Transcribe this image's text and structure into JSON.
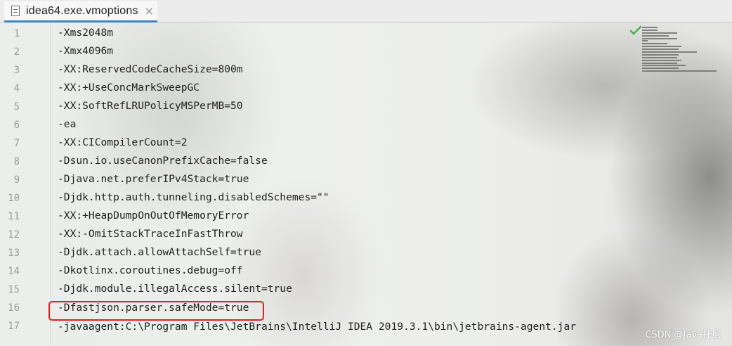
{
  "tab": {
    "title": "idea64.exe.vmoptions",
    "close_glyph": "×",
    "icon": "file-icon"
  },
  "editor": {
    "lines": [
      {
        "num": "1",
        "text": "-Xms2048m"
      },
      {
        "num": "2",
        "text": "-Xmx4096m"
      },
      {
        "num": "3",
        "text": "-XX:ReservedCodeCacheSize=800m"
      },
      {
        "num": "4",
        "text": "-XX:+UseConcMarkSweepGC"
      },
      {
        "num": "5",
        "text": "-XX:SoftRefLRUPolicyMSPerMB=50"
      },
      {
        "num": "6",
        "text": "-ea"
      },
      {
        "num": "7",
        "text": "-XX:CICompilerCount=2"
      },
      {
        "num": "8",
        "text": "-Dsun.io.useCanonPrefixCache=false"
      },
      {
        "num": "9",
        "text": "-Djava.net.preferIPv4Stack=true"
      },
      {
        "num": "10",
        "text": "-Djdk.http.auth.tunneling.disabledSchemes=\"\""
      },
      {
        "num": "11",
        "text": "-XX:+HeapDumpOnOutOfMemoryError"
      },
      {
        "num": "12",
        "text": "-XX:-OmitStackTraceInFastThrow"
      },
      {
        "num": "13",
        "text": "-Djdk.attach.allowAttachSelf=true"
      },
      {
        "num": "14",
        "text": "-Dkotlinx.coroutines.debug=off"
      },
      {
        "num": "15",
        "text": "-Djdk.module.illegalAccess.silent=true"
      },
      {
        "num": "16",
        "text": "-Dfastjson.parser.safeMode=true"
      },
      {
        "num": "17",
        "text": "-javaagent:C:\\Program Files\\JetBrains\\IntelliJ IDEA 2019.3.1\\bin\\jetbrains-agent.jar"
      }
    ],
    "highlighted_line": 16,
    "highlight_color": "#e81d1d"
  },
  "indicators": {
    "status_icon": "check-icon",
    "status_color": "#4caf50"
  },
  "watermark": "CSDN @Java托尼"
}
